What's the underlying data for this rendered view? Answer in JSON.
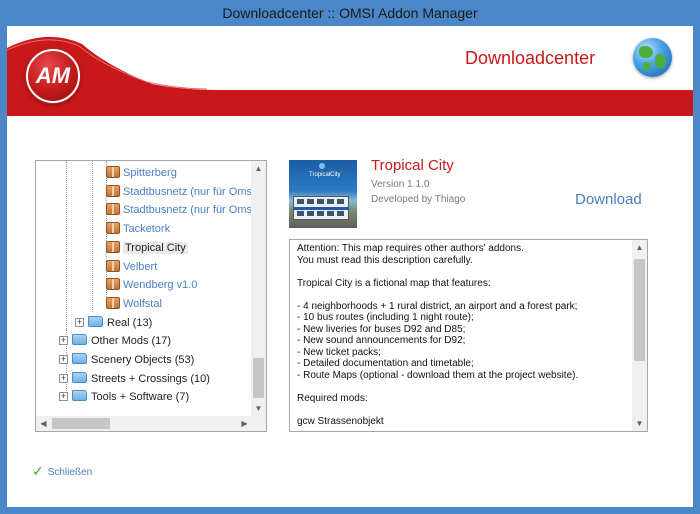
{
  "window": {
    "title": "Downloadcenter :: OMSI Addon Manager"
  },
  "header": {
    "logo_text": "AM",
    "title": "Downloadcenter",
    "brand_color": "#c8181a",
    "icon": "globe-icon"
  },
  "tree": {
    "leaf_items": [
      {
        "label": "Spitterberg",
        "selected": false
      },
      {
        "label": "Stadtbusnetz (nur für Oms",
        "selected": false
      },
      {
        "label": "Stadtbusnetz (nur für Oms",
        "selected": false
      },
      {
        "label": "Tacketork",
        "selected": false
      },
      {
        "label": "Tropical City",
        "selected": true
      },
      {
        "label": "Velbert",
        "selected": false
      },
      {
        "label": "Wendberg v1.0",
        "selected": false
      },
      {
        "label": "Wolfstal",
        "selected": false
      }
    ],
    "sub_folder": {
      "label": "Real (13)",
      "expander": "+"
    },
    "folders": [
      {
        "label": "Other Mods (17)",
        "expander": "+"
      },
      {
        "label": "Scenery Objects (53)",
        "expander": "+"
      },
      {
        "label": "Streets + Crossings (10)",
        "expander": "+"
      },
      {
        "label": "Tools + Software (7)",
        "expander": "+"
      }
    ],
    "scroll_up": "▲",
    "scroll_down": "▼",
    "scroll_left": "◀",
    "scroll_right": "▶"
  },
  "addon": {
    "title": "Tropical City",
    "version": "Version 1.1.0",
    "developer": "Developed by Thiago",
    "download_label": "Download",
    "thumbnail_caption": "TropicalCity"
  },
  "description": {
    "text": "Attention: This map requires other authors' addons.\nYou must read this description carefully.\n\nTropical City is a fictional map that features:\n\n- 4 neighborhoods + 1 rural district, an airport and a forest park;\n- 10 bus routes (including 1 night route);\n- New liveries for buses D92 and D85;\n- New sound announcements for D92;\n- New ticket packs;\n- Detailed documentation and timetable;\n- Route Maps (optional - download them at the project website).\n\nRequired mods:\n\ngcw Strassenobjekt"
  },
  "footer": {
    "close_label": "Schließen",
    "check_icon": "check-icon"
  },
  "colors": {
    "link": "#4a7fc1",
    "accent": "#c8181a",
    "titlebar": "#4a86c8"
  }
}
